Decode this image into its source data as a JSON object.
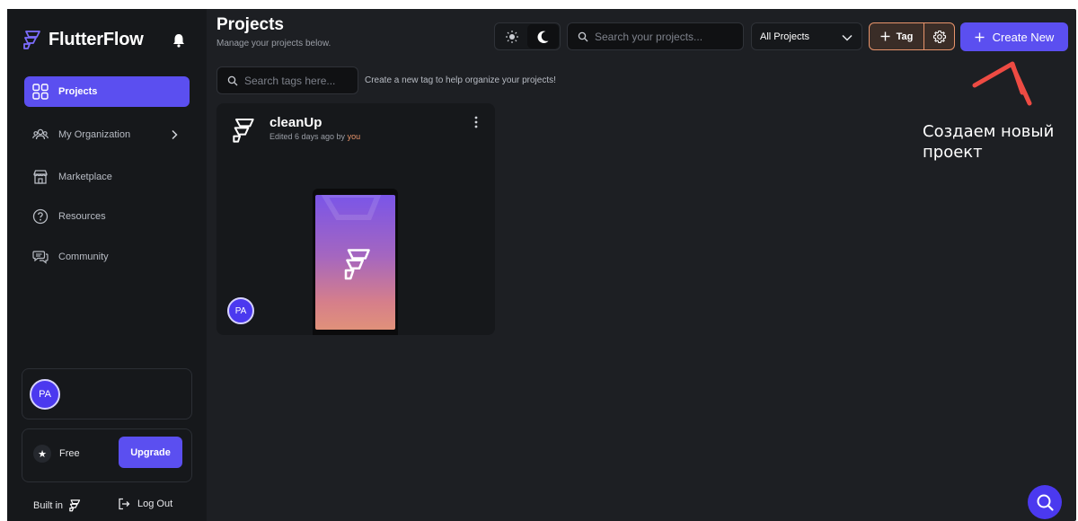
{
  "brand": {
    "name": "FlutterFlow"
  },
  "sidebar": {
    "items": [
      {
        "label": "Projects",
        "icon": "grid-icon",
        "active": true
      },
      {
        "label": "My Organization",
        "icon": "people-icon",
        "has_chevron": true
      },
      {
        "label": "Marketplace",
        "icon": "store-icon"
      },
      {
        "label": "Resources",
        "icon": "help-circle-icon"
      },
      {
        "label": "Community",
        "icon": "chat-icon"
      }
    ],
    "user": {
      "initials": "PA"
    },
    "plan": {
      "label": "Free",
      "upgrade_label": "Upgrade"
    },
    "footer": {
      "built_in": "Built in",
      "logout": "Log Out"
    }
  },
  "header": {
    "title": "Projects",
    "subtitle": "Manage your projects below.",
    "search_placeholder": "Search your projects...",
    "filter_value": "All Projects",
    "tag_label": "Tag",
    "create_label": "Create New"
  },
  "tags": {
    "search_placeholder": "Search tags here...",
    "hint": "Create a new tag to help organize your projects!"
  },
  "project": {
    "name": "cleanUp",
    "edited_prefix": "Edited 6 days ago by",
    "edited_by": "you",
    "owner_initials": "PA"
  },
  "annotation": {
    "text": "Создаем новый проект"
  },
  "colors": {
    "accent": "#5b4ff0",
    "tag_border": "#e8946b",
    "arrow": "#ee4b43",
    "background": "#1d1f23",
    "sidebar": "#16181b"
  }
}
